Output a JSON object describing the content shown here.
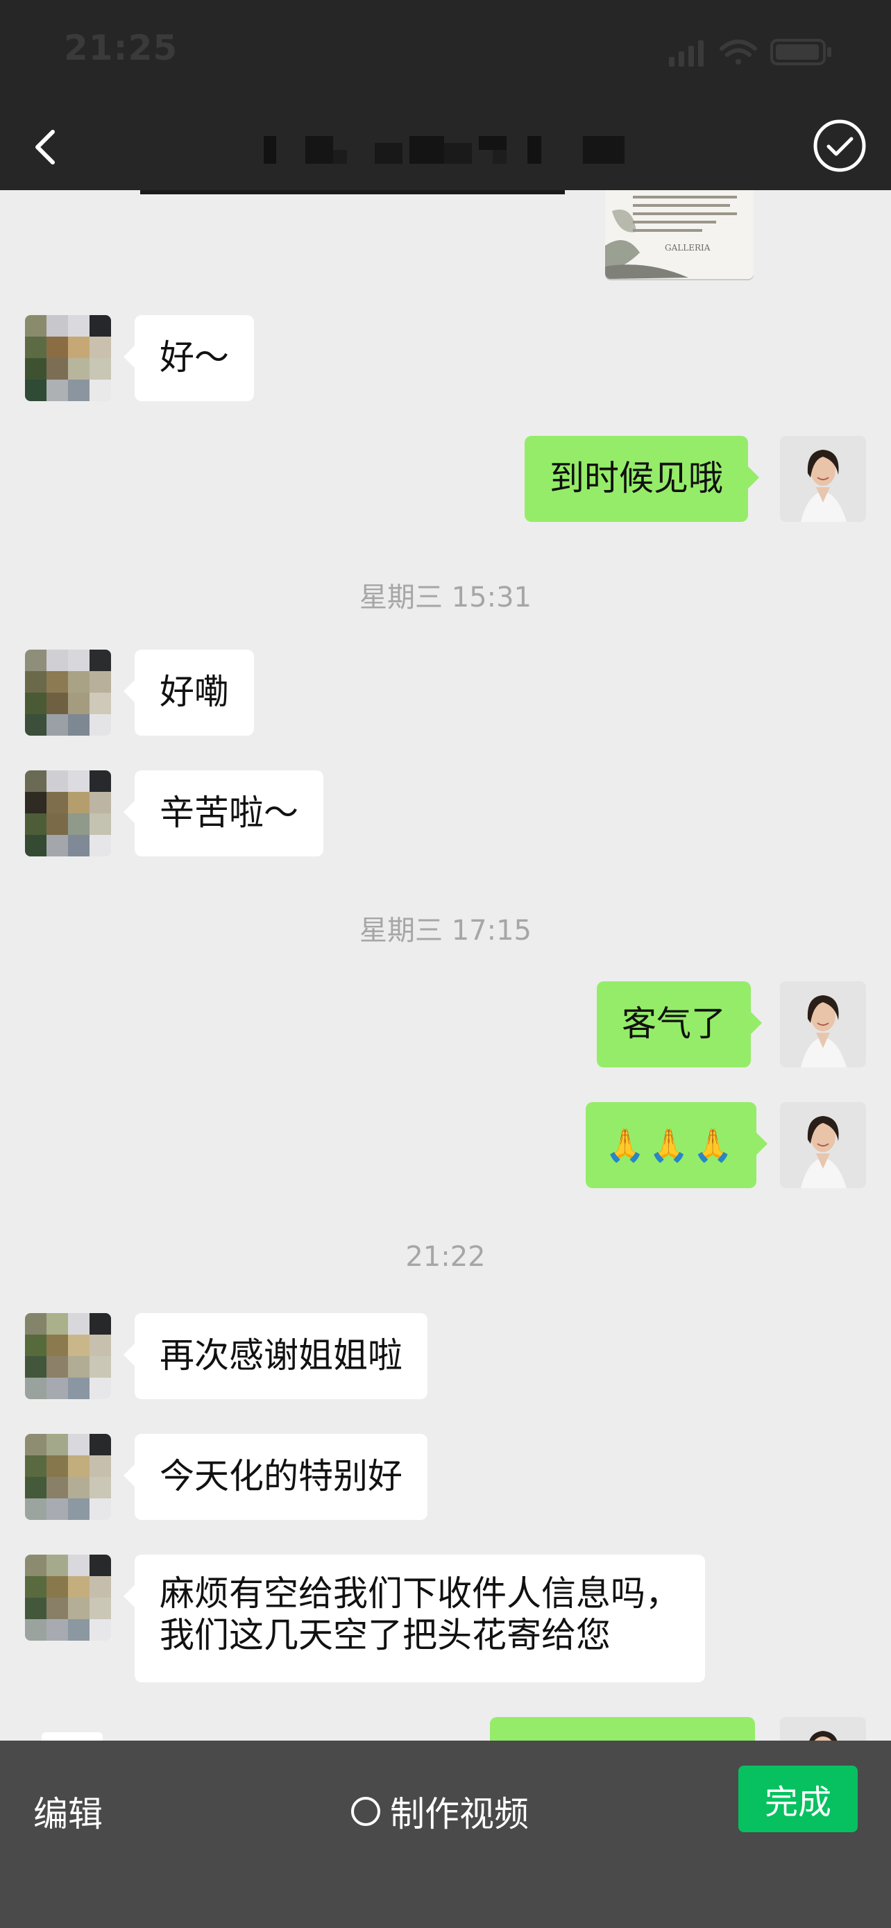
{
  "status_bar": {
    "time": "21:25"
  },
  "nav": {
    "title": ""
  },
  "messages": [
    {
      "type": "in",
      "text": "好～"
    },
    {
      "type": "out",
      "text": "到时候见哦"
    },
    {
      "type": "time",
      "text": "星期三 15:31"
    },
    {
      "type": "in",
      "text": "好嘞"
    },
    {
      "type": "in",
      "text": "辛苦啦～"
    },
    {
      "type": "time",
      "text": "星期三 17:15"
    },
    {
      "type": "out",
      "text": "客气了"
    },
    {
      "type": "out-emoji",
      "text": "🙏🙏🙏"
    },
    {
      "type": "time",
      "text": "21:22"
    },
    {
      "type": "in",
      "text": "再次感谢姐姐啦"
    },
    {
      "type": "in",
      "text": "今天化的特别好"
    },
    {
      "type": "in",
      "line1": "麻烦有空给我们下收件人信息吗，",
      "line2": "我们这几天空了把头花寄给您"
    }
  ],
  "image_card": {
    "brand": "GALLERIA"
  },
  "toolbar": {
    "edit_label": "编辑",
    "video_label": "制作视频",
    "done_label": "完成"
  },
  "colors": {
    "nav_bg": "#262626",
    "chat_bg": "#ededed",
    "outgoing_bubble": "#95ec69",
    "incoming_bubble": "#ffffff",
    "done_button": "#07c160",
    "toolbar_bg": "#4a4a4a"
  }
}
